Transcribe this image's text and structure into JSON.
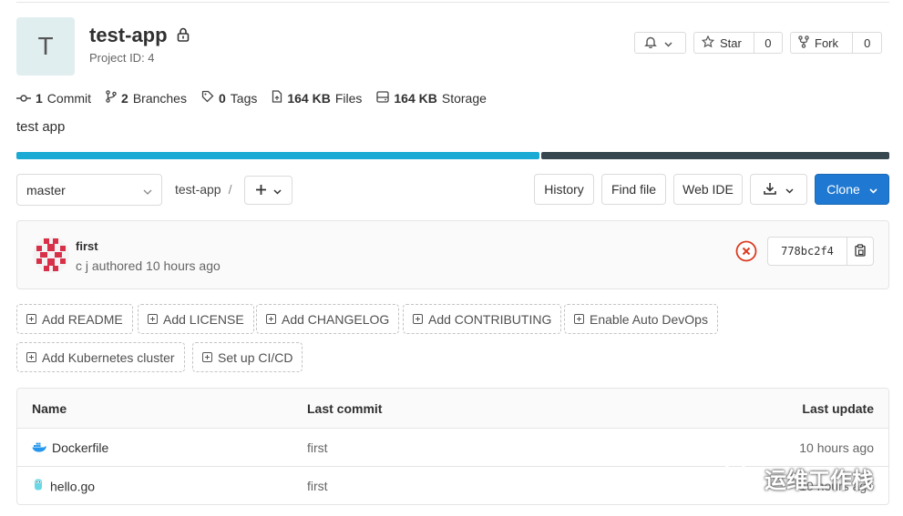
{
  "project": {
    "avatar_letter": "T",
    "name": "test-app",
    "id_text": "Project ID: 4"
  },
  "header_actions": {
    "star_label": "Star",
    "star_count": "0",
    "fork_label": "Fork",
    "fork_count": "0"
  },
  "stats": {
    "commits_num": "1",
    "commits_label": "Commit",
    "branches_num": "2",
    "branches_label": "Branches",
    "tags_num": "0",
    "tags_label": "Tags",
    "files_num": "164 KB",
    "files_label": "Files",
    "storage_num": "164 KB",
    "storage_label": "Storage"
  },
  "description": "test app",
  "language_bar": [
    {
      "color": "#1aaad4",
      "percent": 60
    },
    {
      "color": "#37474f",
      "percent": 40
    }
  ],
  "toolbar": {
    "branch": "master",
    "path_root": "test-app",
    "path_sep": "/",
    "history": "History",
    "find_file": "Find file",
    "web_ide": "Web IDE",
    "clone": "Clone"
  },
  "last_commit": {
    "title": "first",
    "meta": "c j authored 10 hours ago",
    "sha": "778bc2f4",
    "pipeline_status": "failed"
  },
  "quick_actions": [
    "Add README",
    "Add LICENSE",
    "Add CHANGELOG",
    "Add CONTRIBUTING",
    "Enable Auto DevOps",
    "Add Kubernetes cluster",
    "Set up CI/CD"
  ],
  "table": {
    "headers": {
      "name": "Name",
      "last_commit": "Last commit",
      "last_update": "Last update"
    },
    "rows": [
      {
        "icon": "docker-icon",
        "name": "Dockerfile",
        "commit": "first",
        "update": "10 hours ago"
      },
      {
        "icon": "go-icon",
        "name": "hello.go",
        "commit": "first",
        "update": "10 hours ago"
      }
    ]
  },
  "watermark": "运维工作栈"
}
